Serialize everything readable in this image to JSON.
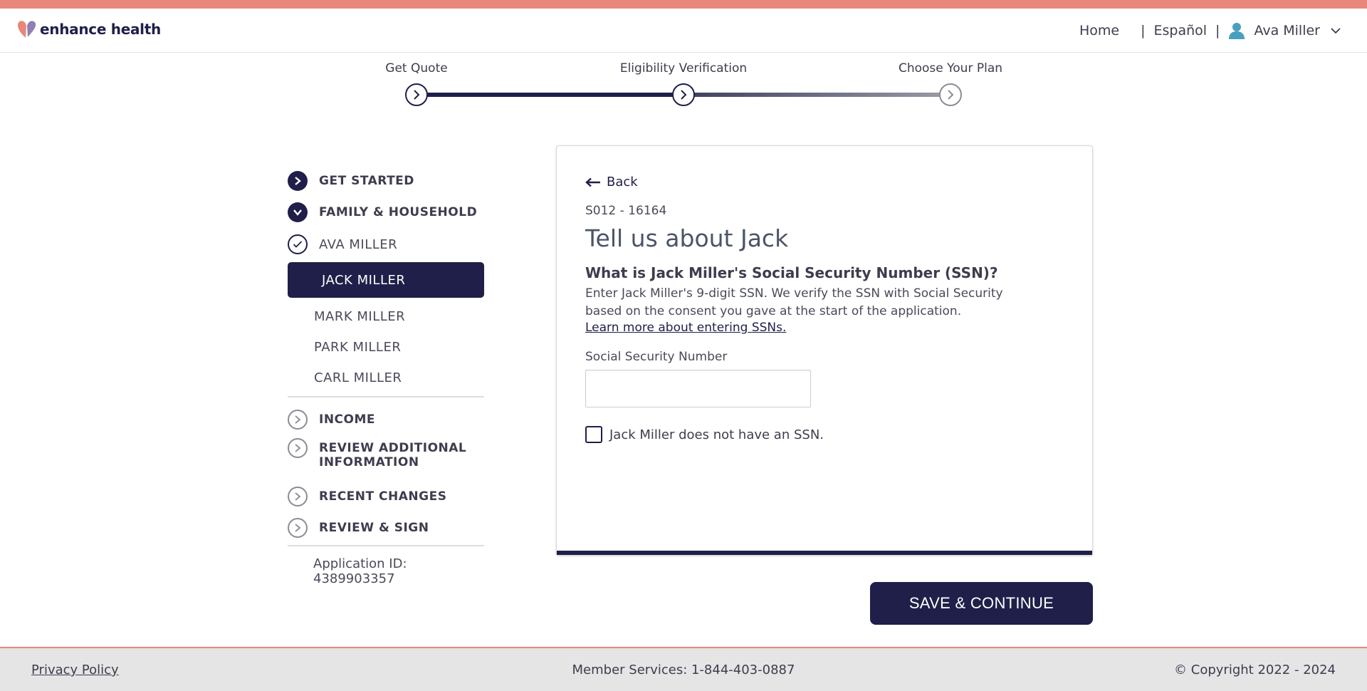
{
  "brand": {
    "name": "enhance health",
    "accent": "#e8877a",
    "primary": "#1f1f4a"
  },
  "nav": {
    "home": "Home",
    "separator": "|",
    "language": "Español",
    "user_name": "Ava Miller"
  },
  "progress": {
    "steps": [
      {
        "label": "Get Quote",
        "state": "complete"
      },
      {
        "label": "Eligibility Verification",
        "state": "current"
      },
      {
        "label": "Choose Your Plan",
        "state": "upcoming"
      }
    ]
  },
  "sidebar": {
    "sections_top": [
      {
        "label": "GET STARTED",
        "icon": "chevron-right-icon"
      },
      {
        "label": "FAMILY & HOUSEHOLD",
        "icon": "chevron-down-icon"
      }
    ],
    "members": [
      {
        "label": "AVA MILLER",
        "state": "done"
      },
      {
        "label": "JACK MILLER",
        "state": "active"
      },
      {
        "label": "MARK MILLER",
        "state": "pending"
      },
      {
        "label": "PARK MILLER",
        "state": "pending"
      },
      {
        "label": "CARL MILLER",
        "state": "pending"
      }
    ],
    "sections_bottom": [
      {
        "label": "INCOME"
      },
      {
        "label": "REVIEW ADDITIONAL",
        "label2": "INFORMATION"
      },
      {
        "label": "RECENT CHANGES"
      },
      {
        "label": "REVIEW & SIGN"
      }
    ],
    "application_id": "Application ID: 4389903357"
  },
  "form": {
    "back": "Back",
    "code": "S012 - 16164",
    "title": "Tell us about Jack",
    "question": "What is Jack Miller's Social Security Number (SSN)?",
    "description_line1": "Enter Jack Miller's 9-digit SSN. We verify the SSN with Social Security",
    "description_line2": "based on the consent you gave at the start of the application.",
    "learn_more": "Learn more about entering SSNs.",
    "ssn_label": "Social Security Number",
    "ssn_value": "",
    "ssn_placeholder": "",
    "no_ssn_label": "Jack Miller does not have an SSN.",
    "no_ssn_checked": false
  },
  "actions": {
    "save_continue": "SAVE & CONTINUE"
  },
  "footer": {
    "privacy": "Privacy Policy",
    "services": "Member Services: 1-844-403-0887",
    "copyright": "© Copyright 2022 - 2024"
  }
}
